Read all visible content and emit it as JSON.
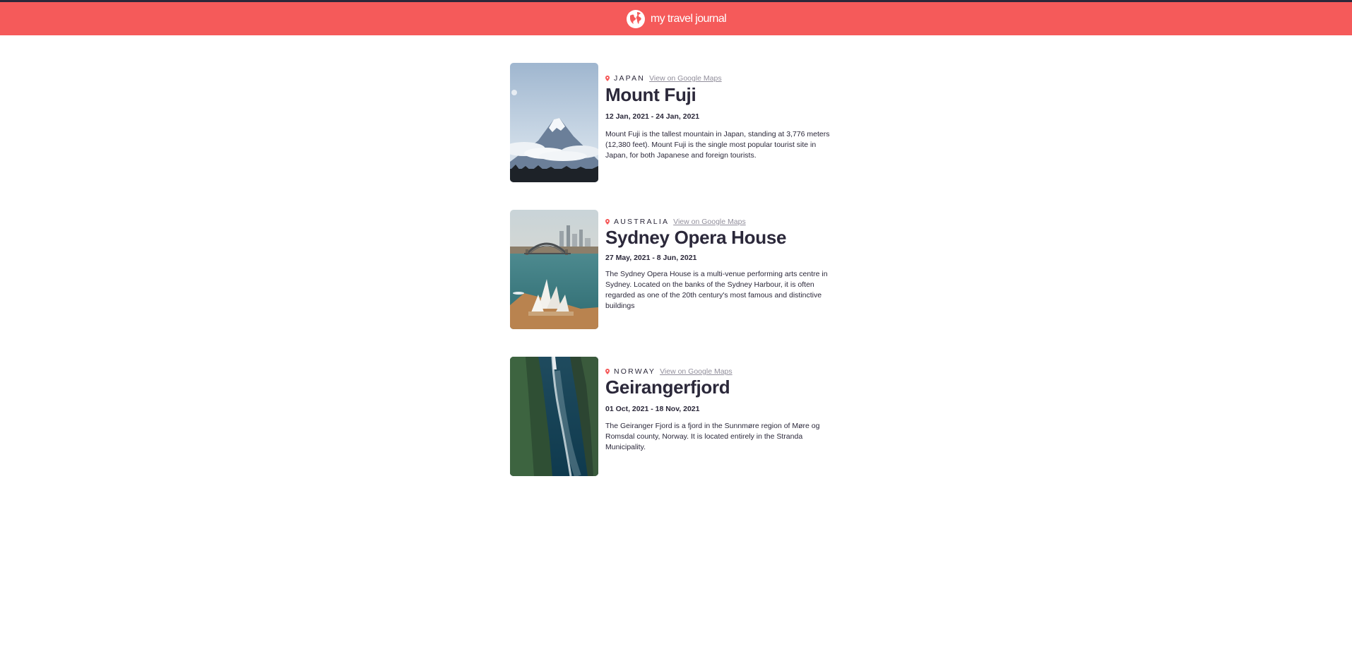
{
  "header": {
    "logo_icon": "globe-icon",
    "title": "my travel journal",
    "background": "#f55a5a"
  },
  "entries": [
    {
      "country": "JAPAN",
      "maps_link": "View on Google Maps",
      "title": "Mount Fuji",
      "dates": "12 Jan, 2021 - 24 Jan, 2021",
      "description": "Mount Fuji is the tallest mountain in Japan, standing at 3,776 meters (12,380 feet). Mount Fuji is the single most popular tourist site in Japan, for both Japanese and foreign tourists."
    },
    {
      "country": "AUSTRALIA",
      "maps_link": "View on Google Maps",
      "title": "Sydney Opera House",
      "dates": "27 May, 2021 - 8 Jun, 2021",
      "description": "The Sydney Opera House is a multi-venue performing arts centre in Sydney. Located on the banks of the Sydney Harbour, it is often regarded as one of the 20th century's most famous and distinctive buildings"
    },
    {
      "country": "NORWAY",
      "maps_link": "View on Google Maps",
      "title": "Geirangerfjord",
      "dates": "01 Oct, 2021 - 18 Nov, 2021",
      "description": "The Geiranger Fjord is a fjord in the Sunnmøre region of Møre og Romsdal county, Norway. It is located entirely in the Stranda Municipality."
    }
  ],
  "icons": {
    "location": "location-pin-icon"
  }
}
